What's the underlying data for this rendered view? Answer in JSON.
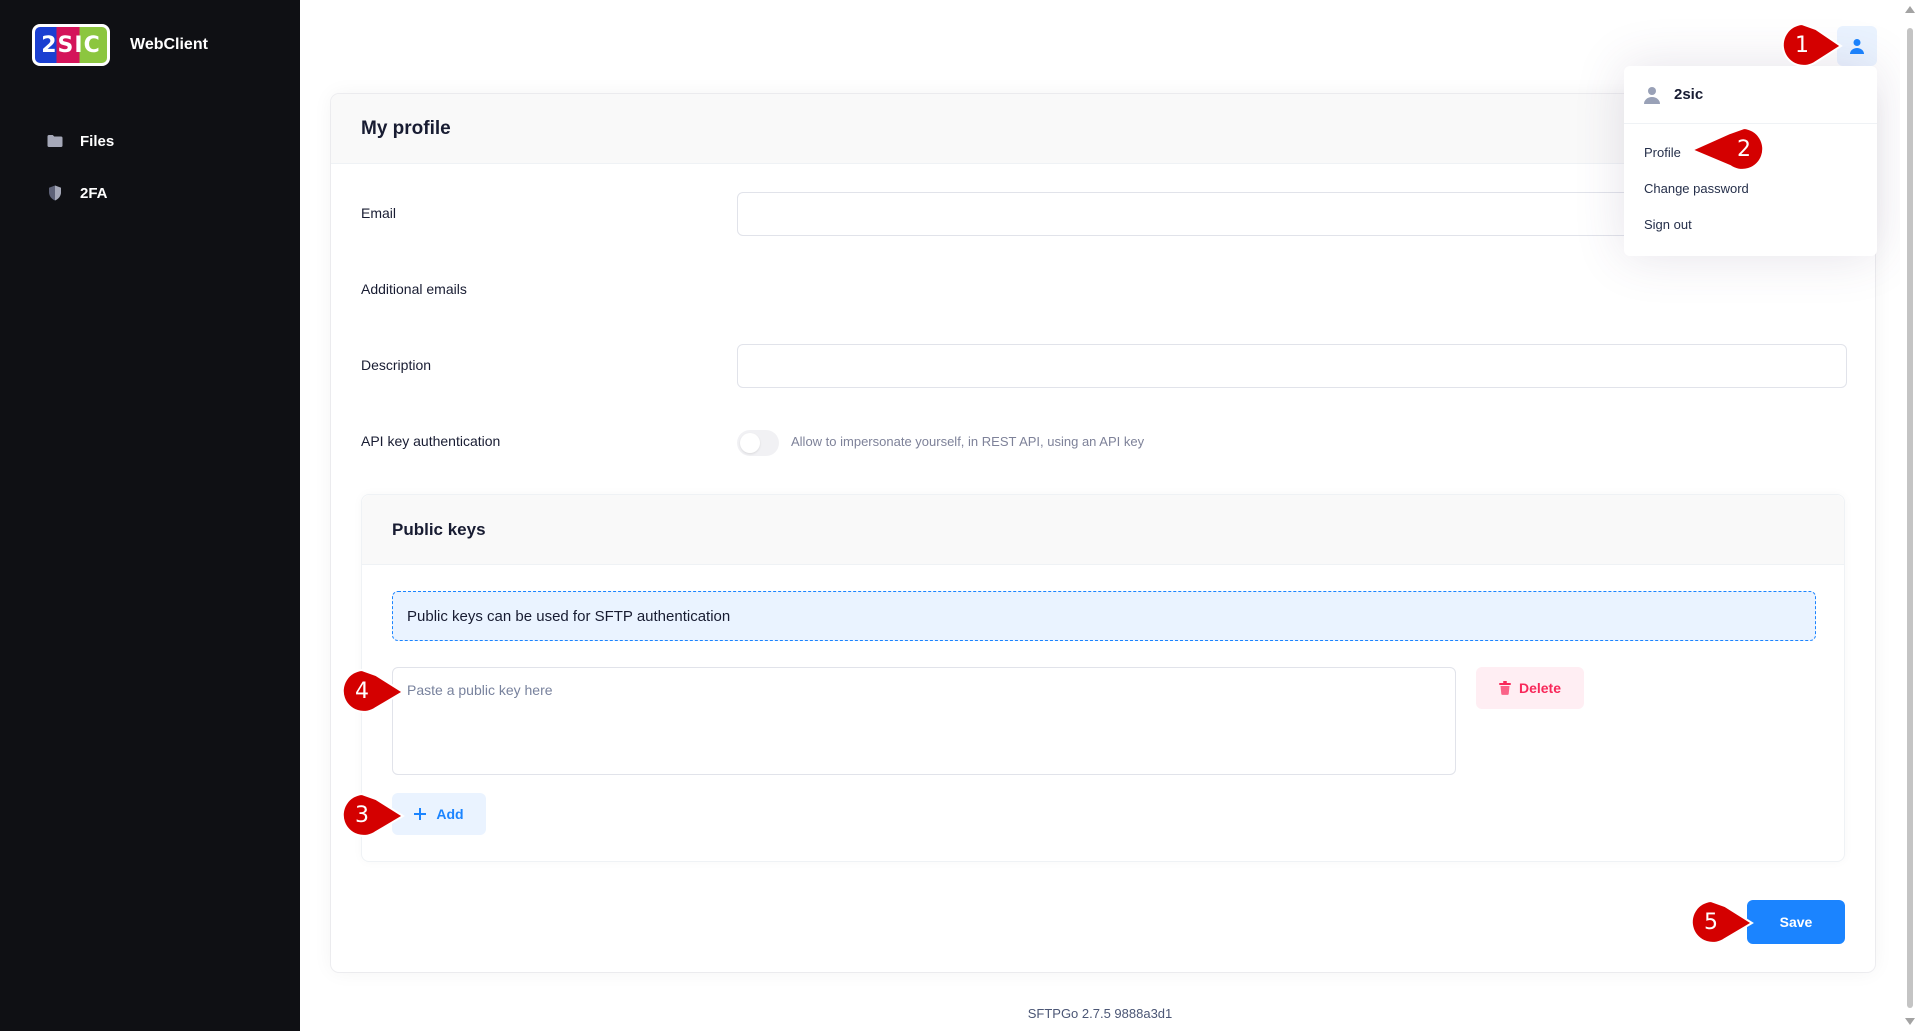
{
  "app": {
    "brand_title": "WebClient",
    "logo_text": "2SIC"
  },
  "sidebar": {
    "items": [
      {
        "label": "Files",
        "icon": "folder-icon"
      },
      {
        "label": "2FA",
        "icon": "shield-icon"
      }
    ]
  },
  "profile": {
    "title": "My profile",
    "email_label": "Email",
    "email_value": "",
    "additional_emails_label": "Additional emails",
    "description_label": "Description",
    "description_value": "",
    "api_key_label": "API key authentication",
    "api_key_hint": "Allow to impersonate yourself, in REST API, using an API key",
    "api_key_enabled": false
  },
  "public_keys": {
    "title": "Public keys",
    "notice": "Public keys can be used for SFTP authentication",
    "placeholder": "Paste a public key here",
    "delete_label": "Delete",
    "add_label": "Add"
  },
  "actions": {
    "save_label": "Save"
  },
  "footer": {
    "version": "SFTPGo 2.7.5 9888a3d1"
  },
  "user_menu": {
    "username": "2sic",
    "items": [
      "Profile",
      "Change password",
      "Sign out"
    ]
  },
  "annotations": [
    "1",
    "2",
    "3",
    "4",
    "5"
  ],
  "colors": {
    "sidebar_bg": "#0f1014",
    "primary": "#1b84ff",
    "danger": "#f8285a",
    "callout": "#d40000"
  }
}
